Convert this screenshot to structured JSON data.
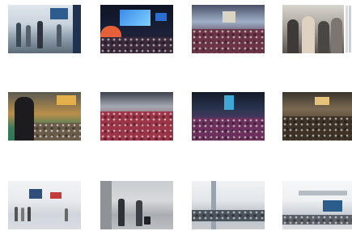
{
  "gallery": {
    "thumbnails": [
      {
        "row": 0,
        "col": 0,
        "colors": {
          "bg": "#c9d3dc",
          "mid": "#7f93a6",
          "floor": "#5b6b78",
          "accent": "#e7e2da"
        }
      },
      {
        "row": 0,
        "col": 1,
        "colors": {
          "bg": "#141a2e",
          "mid": "#2b6fd1",
          "floor": "#6e2c3a",
          "accent": "#f07a3a"
        }
      },
      {
        "row": 0,
        "col": 2,
        "colors": {
          "bg": "#3a3f55",
          "mid": "#9fb0c8",
          "floor": "#7a3b4a",
          "accent": "#d9d4c6"
        }
      },
      {
        "row": 0,
        "col": 3,
        "colors": {
          "bg": "#c7c3bd",
          "mid": "#6d6a66",
          "floor": "#4a4644",
          "accent": "#e0d2c0"
        }
      },
      {
        "row": 1,
        "col": 0,
        "colors": {
          "bg": "#3d3f3a",
          "mid": "#b98e4a",
          "floor": "#2d7a55",
          "accent": "#e3b04b"
        }
      },
      {
        "row": 1,
        "col": 1,
        "colors": {
          "bg": "#4a4e5a",
          "mid": "#a5aab5",
          "floor": "#b32a3c",
          "accent": "#d7d9dd"
        }
      },
      {
        "row": 1,
        "col": 2,
        "colors": {
          "bg": "#1e2434",
          "mid": "#5a6f9a",
          "floor": "#8a2b4f",
          "accent": "#3fa9d6"
        }
      },
      {
        "row": 1,
        "col": 3,
        "colors": {
          "bg": "#2c2823",
          "mid": "#7c6a52",
          "floor": "#4b3d2c",
          "accent": "#e6c27a"
        }
      },
      {
        "row": 2,
        "col": 0,
        "colors": {
          "bg": "#e8eaee",
          "mid": "#b9c2cc",
          "floor": "#d9dde2",
          "accent": "#c43b3b"
        }
      },
      {
        "row": 2,
        "col": 1,
        "colors": {
          "bg": "#d7d9dc",
          "mid": "#8f9296",
          "floor": "#bdbfc2",
          "accent": "#2f3338"
        }
      },
      {
        "row": 2,
        "col": 2,
        "colors": {
          "bg": "#e3e6ea",
          "mid": "#9aa3ad",
          "floor": "#c8ccd1",
          "accent": "#3a4048"
        }
      },
      {
        "row": 2,
        "col": 3,
        "colors": {
          "bg": "#eef0f2",
          "mid": "#b5bcc4",
          "floor": "#dadde1",
          "accent": "#2c5d8a"
        }
      }
    ]
  }
}
